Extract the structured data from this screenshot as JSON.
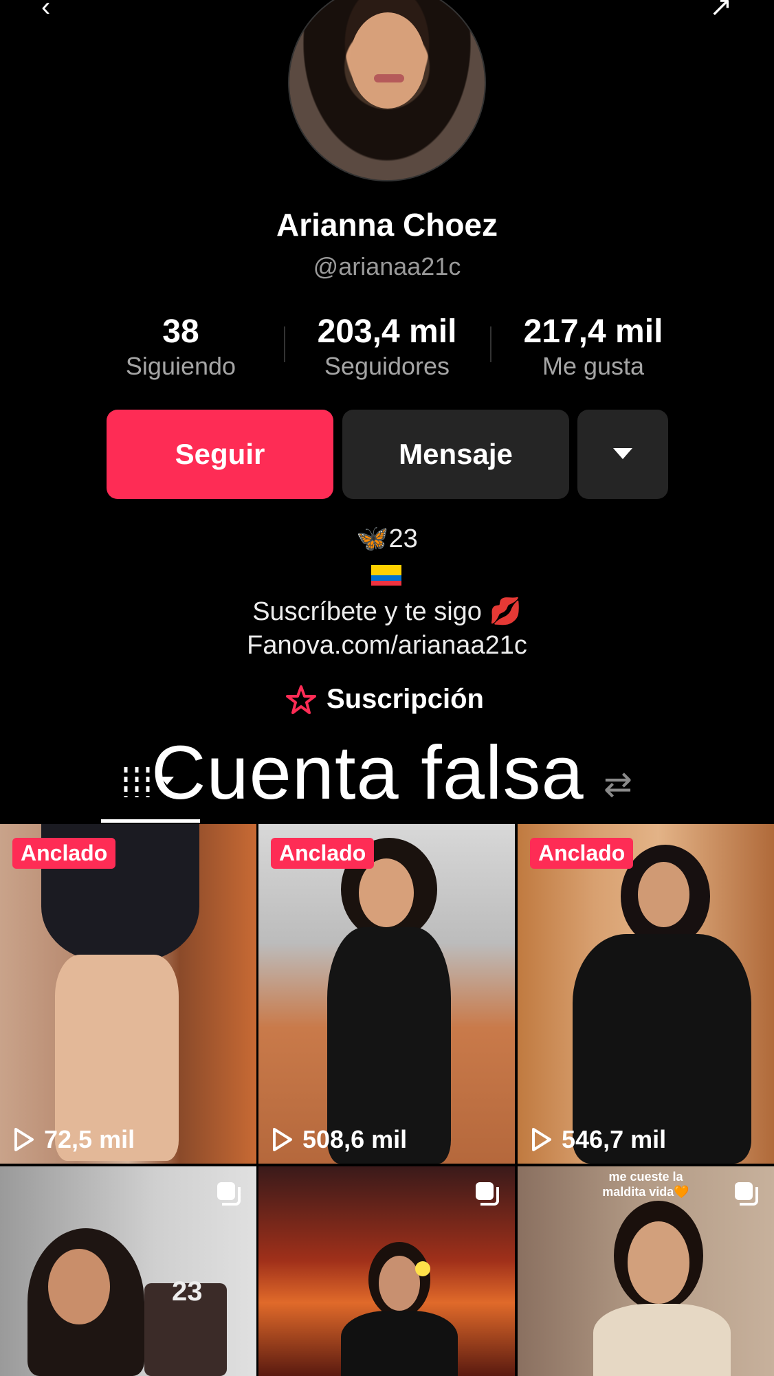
{
  "profile": {
    "name": "Arianna Choez",
    "handle": "@arianaa21c"
  },
  "stats": [
    {
      "value": "38",
      "label": "Siguiendo"
    },
    {
      "value": "203,4 mil",
      "label": "Seguidores"
    },
    {
      "value": "217,4 mil",
      "label": "Me gusta"
    }
  ],
  "actions": {
    "follow_label": "Seguir",
    "message_label": "Mensaje",
    "more_icon": "caret-down-icon"
  },
  "bio": {
    "line1": "🦋23",
    "line2_icon": "ecuador-flag",
    "line3": "Suscríbete y te sigo 💋",
    "line4": "Fanova.com/arianaa21c"
  },
  "subscription": {
    "label": "Suscripción",
    "icon": "star-icon"
  },
  "overlay_text": "Cuenta falsa",
  "tabs": {
    "videos_icon": "grid-icon",
    "reposts_icon": "repost-icon"
  },
  "videos": [
    {
      "pinned": "Anclado",
      "views": "72,5 mil"
    },
    {
      "pinned": "Anclado",
      "views": "508,6 mil"
    },
    {
      "pinned": "Anclado",
      "views": "546,7 mil"
    },
    {
      "caption": ""
    },
    {
      "caption": ""
    },
    {
      "caption": "me cueste la\nmaldita vida🧡"
    }
  ],
  "colors": {
    "accent": "#fe2c55",
    "button_dark": "#252525",
    "background": "#000000"
  }
}
